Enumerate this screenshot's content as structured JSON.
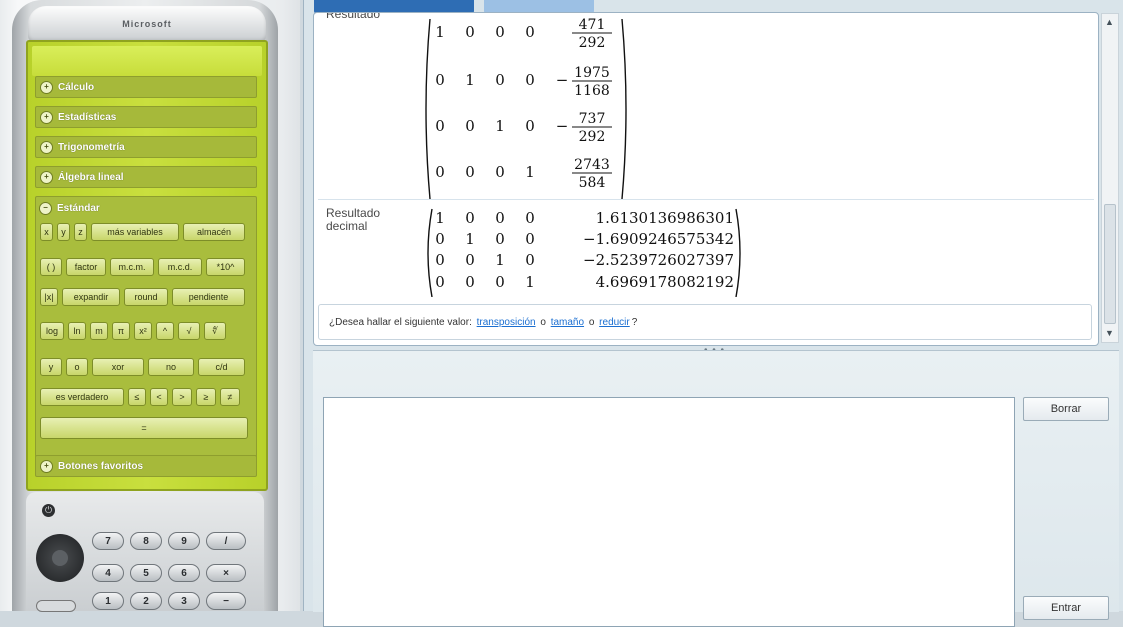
{
  "device": {
    "brand": "Microsoft",
    "categories": [
      {
        "label": "Cálculo",
        "symbol": "+"
      },
      {
        "label": "Estadísticas",
        "symbol": "+"
      },
      {
        "label": "Trigonometría",
        "symbol": "+"
      },
      {
        "label": "Álgebra lineal",
        "symbol": "+"
      },
      {
        "label": "Estándar",
        "symbol": "−"
      },
      {
        "label": "Botones favoritos",
        "symbol": "+"
      }
    ],
    "standard_keys": {
      "row1": [
        "x",
        "y",
        "z",
        "más variables",
        "almacén"
      ],
      "row2": [
        "( )",
        "factor",
        "m.c.m.",
        "m.c.d.",
        "*10^"
      ],
      "row3": [
        "|x|",
        "expandir",
        "round",
        "pendiente"
      ],
      "row4": [
        "log",
        "ln",
        "m",
        "π",
        "x²",
        "^",
        "√",
        "∜"
      ],
      "row5": [
        "y",
        "o",
        "xor",
        "no",
        "c/d"
      ],
      "row6": [
        "es verdadero",
        "≤",
        "<",
        ">",
        "≥",
        "≠"
      ],
      "row7": [
        "="
      ]
    },
    "keypad": {
      "power_label": "⏻",
      "row1": [
        "7",
        "8",
        "9",
        "/"
      ],
      "row2": [
        "4",
        "5",
        "6",
        "×"
      ],
      "row3": [
        "1",
        "2",
        "3",
        "−"
      ]
    }
  },
  "worksheet": {
    "label_exact": "Resultado",
    "exact_matrix": [
      [
        "1",
        "0",
        "0",
        "0",
        "471/292"
      ],
      [
        "0",
        "1",
        "0",
        "0",
        "-1975/1168"
      ],
      [
        "0",
        "0",
        "1",
        "0",
        "-737/292"
      ],
      [
        "0",
        "0",
        "0",
        "1",
        "2743/584"
      ]
    ],
    "label_decimal": "Resultado decimal",
    "decimal_matrix": [
      [
        "1",
        "0",
        "0",
        "0",
        "1.6130136986301"
      ],
      [
        "0",
        "1",
        "0",
        "0",
        "−1.6909246575342"
      ],
      [
        "0",
        "0",
        "1",
        "0",
        "−2.5239726027397"
      ],
      [
        "0",
        "0",
        "0",
        "1",
        "4.6969178082192"
      ]
    ],
    "question_prefix": "¿Desea hallar el siguiente valor: ",
    "link_transpose": "transposición",
    "sep1": " o ",
    "link_size": "tamaño",
    "sep2": " o ",
    "link_reduce": "reducir",
    "question_suffix": "?",
    "scroll_up": "▲",
    "scroll_down": "▼",
    "splitter": "• • •",
    "clear_button": "Borrar",
    "enter_button": "Entrar",
    "input_value": "",
    "cursor_glyph": "I"
  },
  "colors": {
    "screen_green": "#b8d12a",
    "category_bar": "#a6b93a",
    "link_blue": "#1b6fd1",
    "tab_active": "#2e6db4"
  }
}
